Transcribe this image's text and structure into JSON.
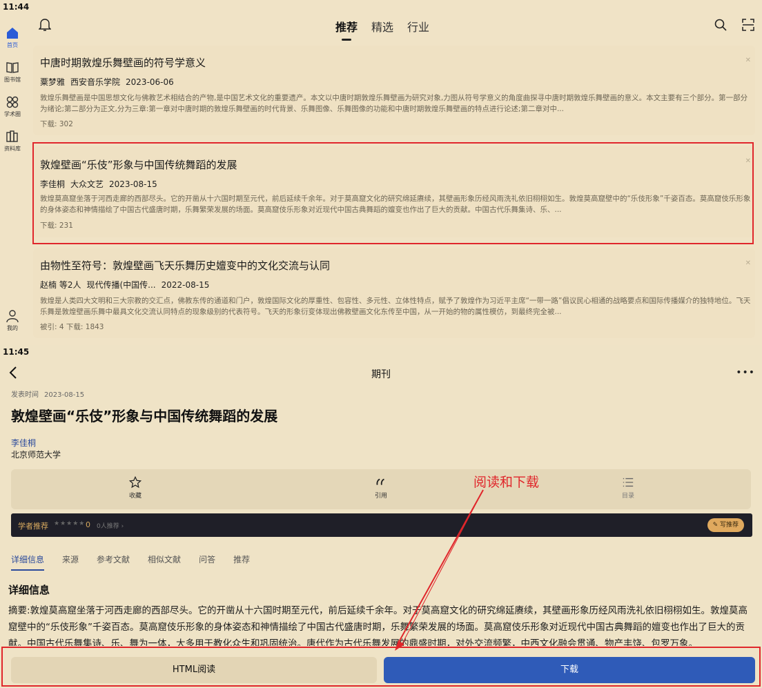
{
  "top": {
    "status_time": "11:44",
    "sidebar": [
      {
        "label": "首页",
        "icon": "home-icon"
      },
      {
        "label": "图书馆",
        "icon": "book-icon"
      },
      {
        "label": "学术圈",
        "icon": "circle-icon"
      },
      {
        "label": "资料库",
        "icon": "library-icon"
      },
      {
        "label": "我的",
        "icon": "user-icon"
      }
    ],
    "tabs": [
      "推荐",
      "精选",
      "行业"
    ],
    "cards": [
      {
        "title": "中唐时期敦煌乐舞壁画的符号学意义",
        "author": "粟梦雅",
        "source": "西安音乐学院",
        "date": "2023-06-06",
        "abstract": "敦煌乐舞壁画是中国思想文化与佛教艺术相结合的产物,是中国艺术文化的重要遗产。本文以中唐时期敦煌乐舞壁画为研究对象,力图从符号学意义的角度曲探寻中唐时期敦煌乐舞壁画的意义。本文主要有三个部分。第一部分为绪论;第二部分为正文,分为三章:第一章对中唐时期的敦煌乐舞壁画的时代背景、乐舞图像、乐舞图像的功能和中唐时期敦煌乐舞壁画的特点进行论述;第二章对中...",
        "stats": "下载: 302"
      },
      {
        "title": "敦煌壁画“乐伎”形象与中国传统舞蹈的发展",
        "author": "李佳桐",
        "source": "大众文艺",
        "date": "2023-08-15",
        "abstract": "敦煌莫高窟坐落于河西走廊的西部尽头。它的开凿从十六国时期至元代，前后延续千余年。对于莫高窟文化的研究绵延赓续，其壁画形象历经风雨洗礼依旧栩栩如生。敦煌莫高窟壁中的“乐伎形象”千姿百态。莫高窟伎乐形象的身体姿态和神情描绘了中国古代盛唐时期，乐舞繁荣发展的场面。莫高窟伎乐形象对近现代中国古典舞蹈的嬗变也作出了巨大的贡献。中国古代乐舞集诗、乐、...",
        "stats": "下载: 231"
      },
      {
        "title": "由物性至符号：敦煌壁画飞天乐舞历史嬗变中的文化交流与认同",
        "author": "赵楠 等2人",
        "source": "现代传播(中国传...",
        "date": "2022-08-15",
        "abstract": "敦煌是人类四大文明和三大宗教的交汇点，佛教东传的通道和门户，敦煌国际文化的厚重性、包容性、多元性、立体性特点，赋予了敦煌作为习近平主席“一带一路”倡议民心相通的战略要点和国际传播媒介的独特地位。飞天乐舞是敦煌壁画乐舞中最具文化交流认同特点的现象级别的代表符号。飞天的形象衍变体现出佛教壁画文化东传至中国，从一开始的物的属性模仿，到最终完全被...",
        "stats": "被引: 4   下载: 1843"
      }
    ]
  },
  "bottom": {
    "status_time": "11:45",
    "header_title": "期刊",
    "pub_label": "发表时间",
    "pub_date": "2023-08-15",
    "title": "敦煌壁画“乐伎”形象与中国传统舞蹈的发展",
    "author": "李佳桐",
    "org": "北京师范大学",
    "actions": [
      {
        "label": "收藏",
        "icon": "star-icon"
      },
      {
        "label": "引用",
        "icon": "quote-icon"
      },
      {
        "label": "目录",
        "icon": "list-icon"
      }
    ],
    "annotation": "阅读和下载",
    "rec": {
      "label": "学者推荐",
      "stars": "★★★★★",
      "score": "0",
      "count": "0人推荐 ›",
      "write": "写推荐"
    },
    "detail_tabs": [
      "详细信息",
      "来源",
      "参考文献",
      "相似文献",
      "问答",
      "推荐"
    ],
    "section_title": "详细信息",
    "abstract": "摘要:敦煌莫高窟坐落于河西走廊的西部尽头。它的开凿从十六国时期至元代，前后延续千余年。对于莫高窟文化的研究绵延赓续，其壁画形象历经风雨洗礼依旧栩栩如生。敦煌莫高窟壁中的“乐伎形象”千姿百态。莫高窟伎乐形象的身体姿态和神情描绘了中国古代盛唐时期，乐舞繁荣发展的场面。莫高窟伎乐形象对近现代中国古典舞蹈的嬗变也作出了巨大的贡献。中国古代乐舞集诗、乐、舞为一体，大多用于教化众生和巩固统治。唐代作为古代乐舞发展的鼎盛时期，对外交流频繁，中西文化融会贯通、物产丰饶、包罗万象。",
    "btn_html": "HTML阅读",
    "btn_download": "下载"
  },
  "colors": {
    "background": "#efe3c6",
    "accent_blue": "#2f5bb8",
    "annotation_red": "#e0262b",
    "rec_bar": "#1f1f28",
    "gold": "#e0a95e"
  }
}
